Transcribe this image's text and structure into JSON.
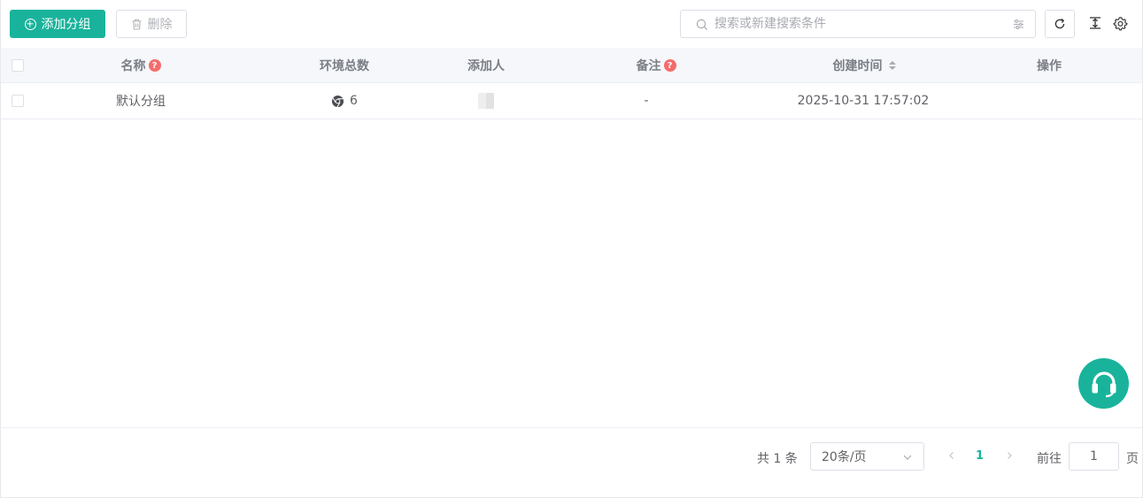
{
  "toolbar": {
    "add_group_label": "添加分组",
    "delete_label": "删除",
    "search_placeholder": "搜索或新建搜索条件"
  },
  "table": {
    "columns": {
      "name": "名称",
      "env_total": "环境总数",
      "added_by": "添加人",
      "remark": "备注",
      "created_time": "创建时间",
      "actions": "操作"
    },
    "rows": [
      {
        "name": "默认分组",
        "env_total": "6",
        "added_by": "",
        "remark": "-",
        "created_time": "2025-10-31 17:57:02",
        "actions": ""
      }
    ]
  },
  "pagination": {
    "total_text": "共 1 条",
    "page_size": "20条/页",
    "current_page": "1",
    "goto_label": "前往",
    "goto_value": "1",
    "page_suffix": "页"
  },
  "colors": {
    "accent": "#19b39b",
    "help_badge": "#f56c6c"
  },
  "icons": {
    "add": "plus-circle-icon",
    "delete": "trash-icon",
    "search": "search-icon",
    "filter": "sliders-icon",
    "refresh": "refresh-icon",
    "row_height": "column-height-icon",
    "settings": "gear-icon",
    "browser": "chrome-icon",
    "support": "headset-icon"
  }
}
